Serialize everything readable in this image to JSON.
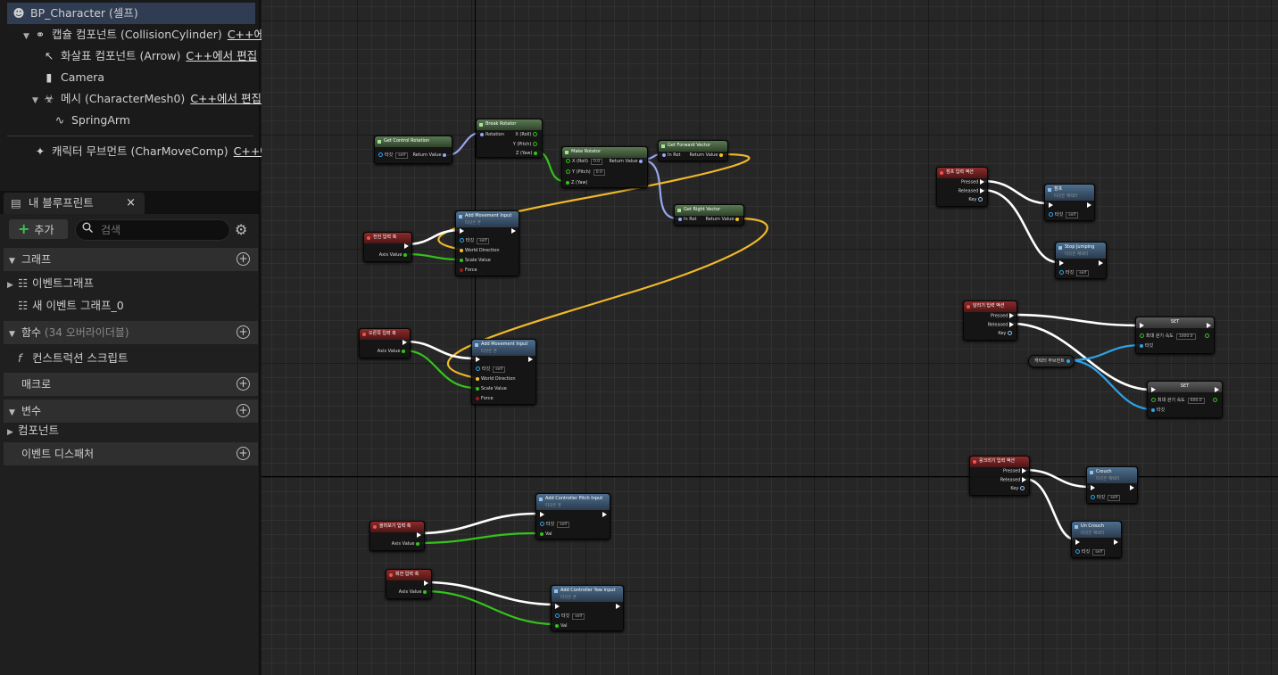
{
  "components": {
    "root_label": "BP_Character (셀프)",
    "capsule_label": "캡슐 컴포넌트 (CollisionCylinder)",
    "capsule_link": "C++에",
    "arrow_label": "화살표 컴포넌트 (Arrow)",
    "arrow_link": "C++에서 편집",
    "camera_label": "Camera",
    "mesh_label": "메시 (CharacterMesh0)",
    "mesh_link": "C++에서 편집",
    "springarm_label": "SpringArm",
    "movement_label": "캐릭터 무브먼트 (CharMoveComp)",
    "movement_link": "C++에"
  },
  "my_blueprint": {
    "tab_label": "내 블루프린트",
    "close": "×",
    "add_label": "추가",
    "search_placeholder": "검색",
    "cat_graphs": "그래프",
    "graph_item_1": "이벤트그래프",
    "graph_item_2": "새 이벤트 그래프_0",
    "cat_functions": "함수",
    "functions_sub": "(34 오버라이더블)",
    "function_item_1": "컨스트럭션 스크립트",
    "cat_macros": "매크로",
    "cat_variables": "변수",
    "variable_item_1": "컴포넌트",
    "cat_dispatchers": "이벤트 디스패처"
  },
  "nodes": {
    "get_control_rotation": {
      "title": "Get Control Rotation",
      "target": "타깃",
      "self": "self",
      "ret": "Return Value"
    },
    "break_rotator": {
      "title": "Break Rotator",
      "rotation": "Rotation",
      "x": "X (Roll)",
      "y": "Y (Pitch)",
      "z": "Z (Yaw)"
    },
    "make_rotator": {
      "title": "Make Rotator",
      "x": "X (Roll)",
      "y": "Y (Pitch)",
      "z": "Z (Yaw)",
      "xv": "0.0",
      "yv": "0.0",
      "ret": "Return Value"
    },
    "get_forward_vector": {
      "title": "Get Forward Vector",
      "inrot": "In Rot",
      "ret": "Return Value"
    },
    "get_right_vector": {
      "title": "Get Right Vector",
      "inrot": "In Rot",
      "ret": "Return Value"
    },
    "forward_axis": {
      "title": "전진 입력 축",
      "axis": "Axis Value"
    },
    "right_axis": {
      "title": "오른쪽 입력 축",
      "axis": "Axis Value"
    },
    "lookup_axis": {
      "title": "올려보기 입력 축",
      "axis": "Axis Value"
    },
    "turn_axis": {
      "title": "회전 입력 축",
      "axis": "Axis Value"
    },
    "add_movement_1": {
      "title": "Add Movement Input",
      "sub": "타깃은 폰",
      "target": "타깃",
      "self": "self",
      "dir": "World Direction",
      "scale": "Scale Value",
      "force": "Force"
    },
    "add_movement_2": {
      "title": "Add Movement Input",
      "sub": "타깃은 폰",
      "target": "타깃",
      "self": "self",
      "dir": "World Direction",
      "scale": "Scale Value",
      "force": "Force"
    },
    "add_pitch": {
      "title": "Add Controller Pitch Input",
      "sub": "타깃은 폰",
      "target": "타깃",
      "self": "self",
      "val": "Val"
    },
    "add_yaw": {
      "title": "Add Controller Yaw Input",
      "sub": "타깃은 폰",
      "target": "타깃",
      "self": "self",
      "val": "Val"
    },
    "jump_action": {
      "title": "점프 입력 액션",
      "pressed": "Pressed",
      "released": "Released",
      "key": "Key"
    },
    "jump": {
      "title": "점프",
      "sub": "타깃은 캐릭터",
      "target": "타깃",
      "self": "self"
    },
    "stop_jumping": {
      "title": "Stop Jumping",
      "sub": "타깃은 캐릭터",
      "target": "타깃",
      "self": "self"
    },
    "run_action": {
      "title": "달리기 입력 액션",
      "pressed": "Pressed",
      "released": "Released",
      "key": "Key"
    },
    "set_1": {
      "title": "SET",
      "speed": "최대 걷기 속도",
      "speed_val": "1000.0",
      "target": "타깃"
    },
    "char_movement": {
      "title": "캐릭터 무브먼트"
    },
    "set_2": {
      "title": "SET",
      "speed": "최대 걷기 속도",
      "speed_val": "600.0",
      "target": "타깃"
    },
    "crouch_action": {
      "title": "웅크리기 입력 액션",
      "pressed": "Pressed",
      "released": "Released",
      "key": "Key"
    },
    "crouch": {
      "title": "Crouch",
      "sub": "타깃은 캐릭터",
      "target": "타깃",
      "self": "self"
    },
    "uncrouch": {
      "title": "Un Crouch",
      "sub": "타깃은 캐릭터",
      "target": "타깃",
      "self": "self"
    }
  },
  "colors": {
    "exec": "#ffffff",
    "float": "#35c21b",
    "vector": "#f7c12b",
    "rotator": "#9aa6f0",
    "object": "#2ea3e8"
  }
}
